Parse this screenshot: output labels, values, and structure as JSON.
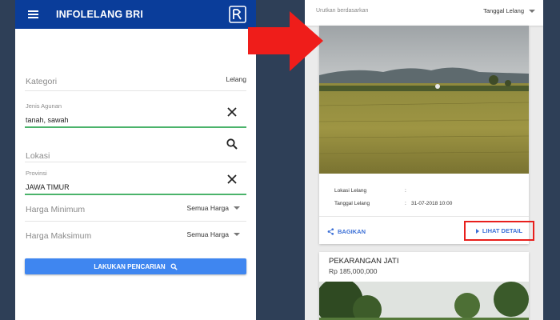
{
  "left": {
    "app_title": "INFOLELANG BRI",
    "fields": {
      "kategori": {
        "label": "Kategori",
        "value": "Lelang"
      },
      "jenis_agunan": {
        "label": "Jenis Agunan",
        "value": "tanah, sawah"
      },
      "lokasi": {
        "label": "Lokasi"
      },
      "provinsi": {
        "label": "Provinsi",
        "value": "JAWA TIMUR"
      },
      "harga_min": {
        "label": "Harga Minimum",
        "value": "Semua Harga"
      },
      "harga_max": {
        "label": "Harga Maksimum",
        "value": "Semua Harga"
      }
    },
    "search_button": "LAKUKAN PENCARIAN"
  },
  "right": {
    "sort": {
      "label": "Urutkan berdasarkan",
      "value": "Tanggal Lelang"
    },
    "card1": {
      "lokasi_label": "Lokasi Lelang",
      "lokasi_value": "",
      "tanggal_label": "Tanggal Lelang",
      "tanggal_value": "31-07-2018 10:00",
      "share": "BAGIKAN",
      "detail": "LIHAT DETAIL"
    },
    "card2": {
      "title": "PEKARANGAN JATI",
      "price": "Rp 185,000,000"
    }
  },
  "colors": {
    "appbar": "#0a3d9a",
    "accent_green": "#4bb36b",
    "button_blue": "#3f86f0",
    "highlight_red": "#e8201d",
    "link_blue": "#3b6fd6"
  }
}
